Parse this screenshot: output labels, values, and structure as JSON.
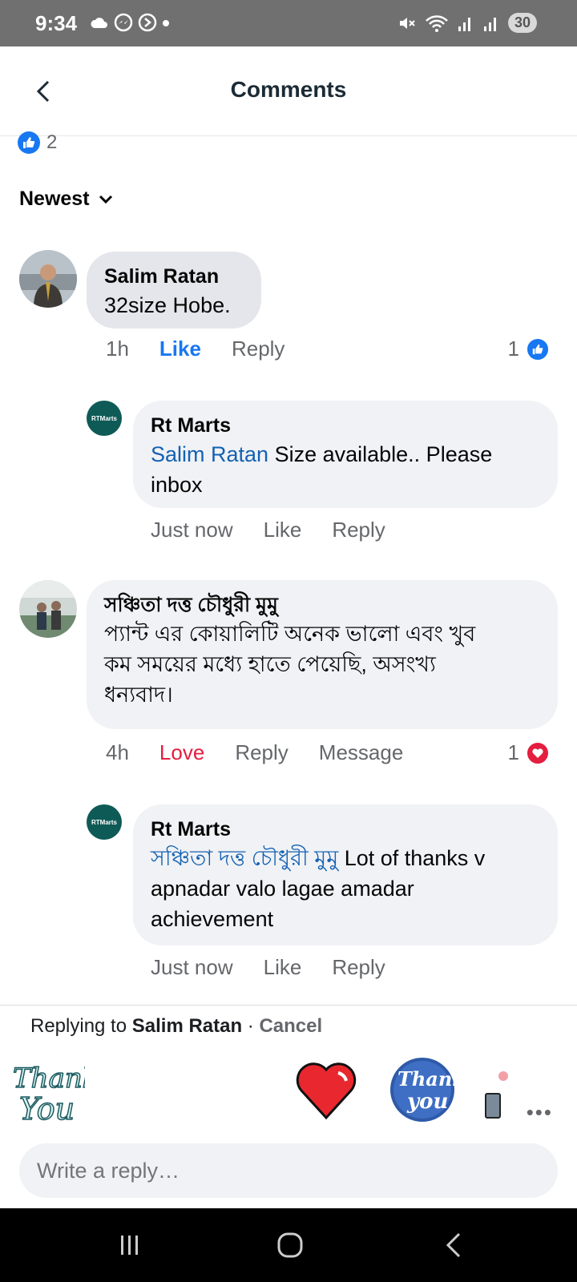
{
  "status_bar": {
    "time": "9:34",
    "battery": "30"
  },
  "header": {
    "title": "Comments"
  },
  "post_reactions": {
    "count": "2"
  },
  "sort": {
    "label": "Newest"
  },
  "comments": [
    {
      "author": "Salim Ratan",
      "text": "32size Hobe.",
      "time": "1h",
      "like_label": "Like",
      "reply_label": "Reply",
      "reaction_count": "1"
    },
    {
      "author": "Rt Marts",
      "avatar_text": "RTMarts",
      "mention": "Salim Ratan",
      "text_line1": " Size available.. Please",
      "text_line2": "inbox",
      "time": "Just now",
      "like_label": "Like",
      "reply_label": "Reply"
    },
    {
      "author": "সঞ্চিতা দত্ত চৌধুরী মুমু",
      "text_line1": "প্যান্ট এর কোয়ালিটি অনেক ভালো এবং খুব",
      "text_line2": "কম সময়ের মধ্যে হাতে পেয়েছি, অসংখ্য",
      "text_line3": "ধন্যবাদ।",
      "time": "4h",
      "love_label": "Love",
      "reply_label": "Reply",
      "message_label": "Message",
      "reaction_count": "1"
    },
    {
      "author": "Rt Marts",
      "avatar_text": "RTMarts",
      "mention": "সঞ্চিতা দত্ত চৌধুরী মুমু",
      "text_line1": " Lot of thanks v",
      "text_line2": "apnadar valo lagae amadar",
      "text_line3": "achievement",
      "time": "Just now",
      "like_label": "Like",
      "reply_label": "Reply"
    }
  ],
  "reply_bar": {
    "prefix": "Replying to ",
    "target": "Salim Ratan",
    "separator": " · ",
    "cancel": "Cancel",
    "placeholder": "Write a reply…"
  },
  "stickers": [
    {
      "name": "thank-you-script-sticker",
      "text": "Thank You"
    },
    {
      "name": "heart-sticker"
    },
    {
      "name": "thank-you-badge-sticker",
      "text": "Thank you"
    }
  ],
  "colors": {
    "accent": "#1877f2",
    "love": "#e41e3f",
    "mention": "#1461b3"
  }
}
